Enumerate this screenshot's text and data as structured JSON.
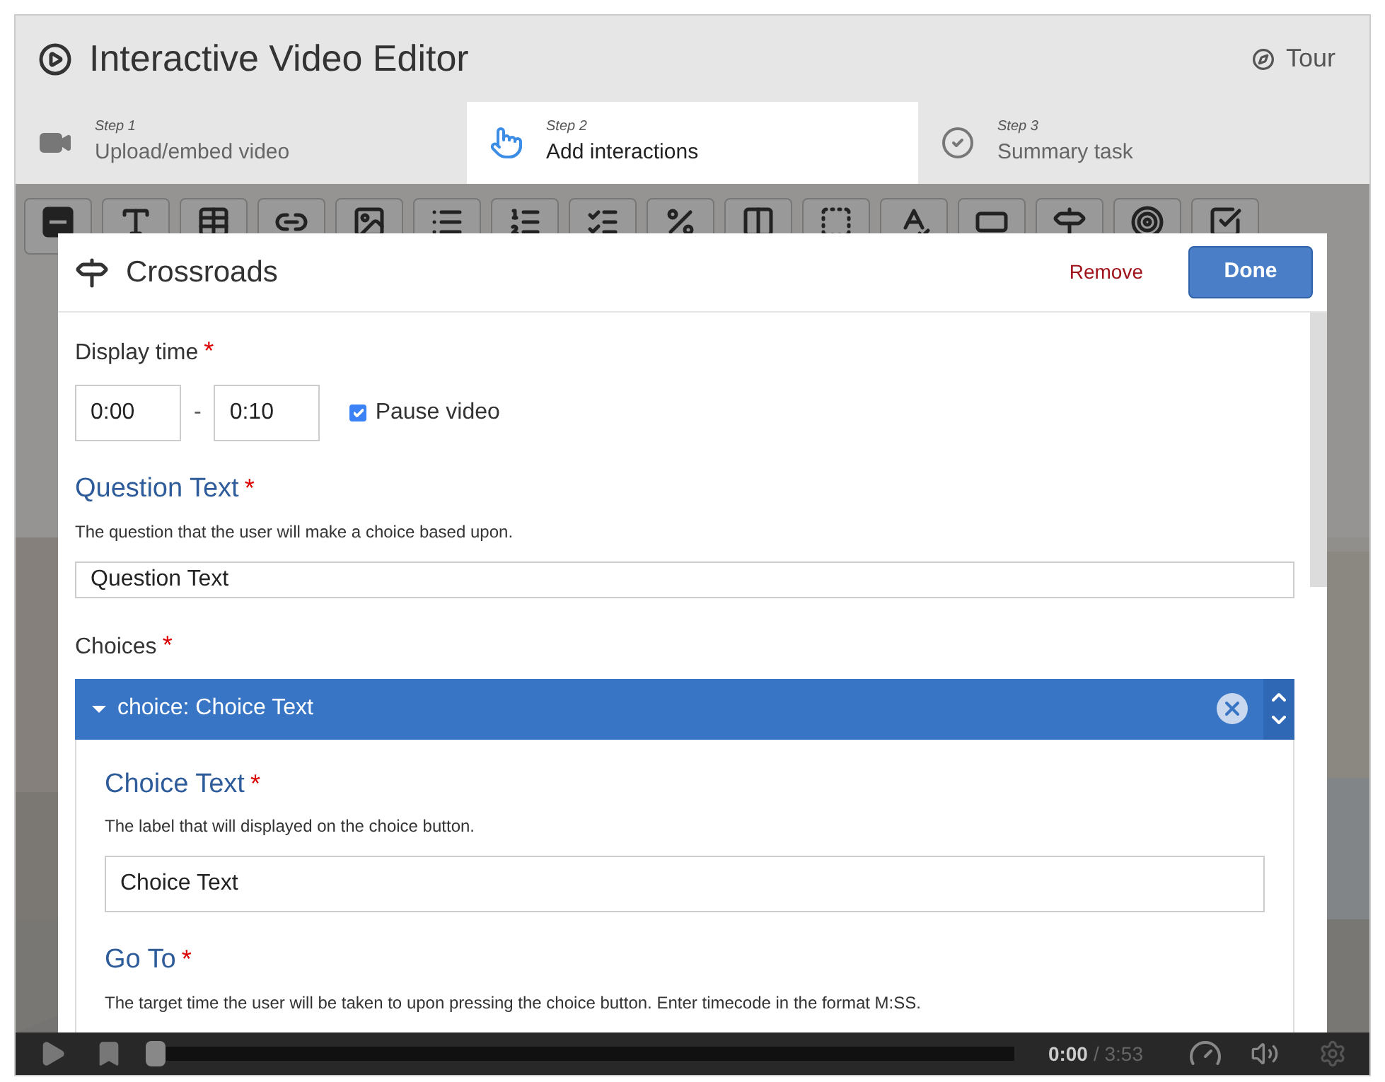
{
  "window": {
    "title": "Interactive Video Editor",
    "tour": "Tour"
  },
  "steps": [
    {
      "step": "Step 1",
      "label": "Upload/embed video",
      "kind": "video",
      "selected": false
    },
    {
      "step": "Step 2",
      "label": "Add interactions",
      "kind": "interactions",
      "selected": true
    },
    {
      "step": "Step 3",
      "label": "Summary task",
      "kind": "summary",
      "selected": false
    }
  ],
  "dialog": {
    "title": "Crossroads",
    "remove": "Remove",
    "done": "Done",
    "display_time": {
      "label": "Display time",
      "required": "*",
      "from": "0:00",
      "separator": "-",
      "to": "0:10",
      "pause": {
        "label": "Pause video",
        "checked": true
      }
    },
    "question": {
      "label": "Question Text",
      "required": "*",
      "description": "The question that the user will make a choice based upon.",
      "value": "Question Text"
    },
    "choices": {
      "label": "Choices",
      "required": "*",
      "items": [
        {
          "title": "choice: Choice Text",
          "expanded": true,
          "fields": [
            {
              "label": "Choice Text",
              "required": "*",
              "description": "The label that will displayed on the choice button.",
              "value": "Choice Text"
            },
            {
              "label": "Go To",
              "required": "*",
              "description": "The target time the user will be taken to upon pressing the choice button. Enter timecode in the format M:SS."
            }
          ]
        }
      ]
    }
  },
  "player": {
    "current": "0:00",
    "total": "/ 3:53",
    "level": 0
  }
}
